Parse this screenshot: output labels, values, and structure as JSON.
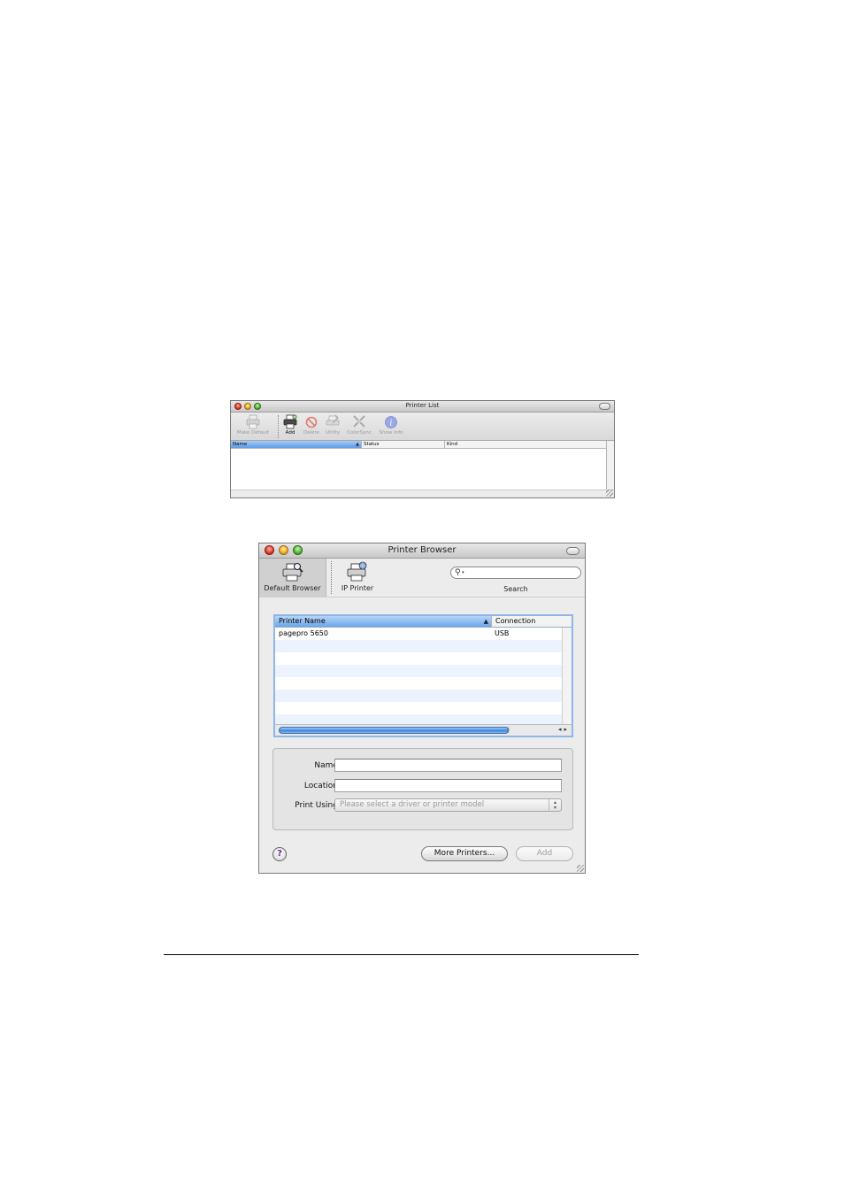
{
  "printer_list": {
    "title": "Printer List",
    "toolbar": [
      {
        "label": "Make Default",
        "icon": "printer-icon"
      },
      {
        "label": "Add",
        "icon": "add-printer-icon"
      },
      {
        "label": "Delete",
        "icon": "delete-icon"
      },
      {
        "label": "Utility",
        "icon": "utility-icon"
      },
      {
        "label": "ColorSync",
        "icon": "colorsync-icon"
      },
      {
        "label": "Show Info",
        "icon": "info-icon"
      }
    ],
    "columns": [
      "Name",
      "Status",
      "Kind"
    ]
  },
  "printer_browser": {
    "title": "Printer Browser",
    "tabs": [
      {
        "label": "Default Browser",
        "icon": "default-browser-icon"
      },
      {
        "label": "IP Printer",
        "icon": "ip-printer-icon"
      }
    ],
    "search": {
      "label": "Search",
      "value": ""
    },
    "columns": [
      "Printer Name",
      "Connection"
    ],
    "rows": [
      {
        "name": "pagepro 5650",
        "connection": "USB"
      }
    ],
    "form": {
      "name_label": "Name:",
      "name_value": "",
      "location_label": "Location:",
      "location_value": "",
      "print_using_label": "Print Using:",
      "print_using_value": "Please select a driver or printer model"
    },
    "buttons": {
      "help": "?",
      "more_printers": "More Printers...",
      "add": "Add"
    }
  }
}
